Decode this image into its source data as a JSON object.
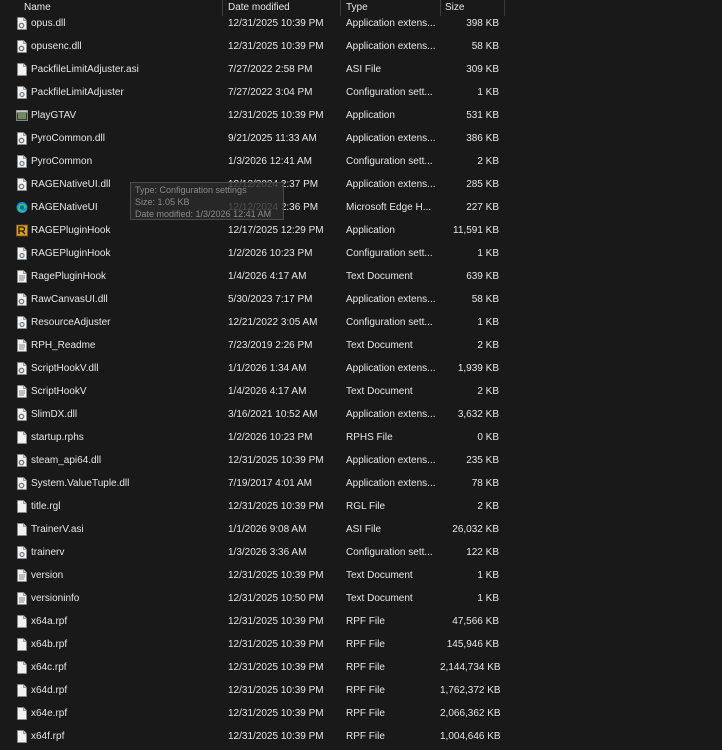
{
  "columns": {
    "name": "Name",
    "date": "Date modified",
    "type": "Type",
    "size": "Size"
  },
  "tooltip": {
    "type_line": "Type: Configuration settings",
    "size_line": "Size: 1.05 KB",
    "date_line": "Date modified: 1/3/2026 12:41 AM"
  },
  "rows": [
    {
      "name": "opus.dll",
      "date": "12/31/2025 10:39 PM",
      "type": "Application extens...",
      "size": "398 KB",
      "icon": "dll-file-icon"
    },
    {
      "name": "opusenc.dll",
      "date": "12/31/2025 10:39 PM",
      "type": "Application extens...",
      "size": "58 KB",
      "icon": "dll-file-icon"
    },
    {
      "name": "PackfileLimitAdjuster.asi",
      "date": "7/27/2022 2:58 PM",
      "type": "ASI File",
      "size": "309 KB",
      "icon": "file-icon"
    },
    {
      "name": "PackfileLimitAdjuster",
      "date": "7/27/2022 3:04 PM",
      "type": "Configuration sett...",
      "size": "1 KB",
      "icon": "config-file-icon"
    },
    {
      "name": "PlayGTAV",
      "date": "12/31/2025 10:39 PM",
      "type": "Application",
      "size": "531 KB",
      "icon": "app-icon"
    },
    {
      "name": "PyroCommon.dll",
      "date": "9/21/2025 11:33 AM",
      "type": "Application extens...",
      "size": "386 KB",
      "icon": "dll-file-icon"
    },
    {
      "name": "PyroCommon",
      "date": "1/3/2026 12:41 AM",
      "type": "Configuration sett...",
      "size": "2 KB",
      "icon": "config-file-icon"
    },
    {
      "name": "RAGENativeUI.dll",
      "date": "12/12/2024 2:37 PM",
      "type": "Application extens...",
      "size": "285 KB",
      "icon": "dll-file-icon"
    },
    {
      "name": "RAGENativeUI",
      "date": "12/12/2024 2:36 PM",
      "type": "Microsoft Edge H...",
      "size": "227 KB",
      "icon": "edge-icon"
    },
    {
      "name": "RAGEPluginHook",
      "date": "12/17/2025 12:29 PM",
      "type": "Application",
      "size": "11,591 KB",
      "icon": "rph-app-icon"
    },
    {
      "name": "RAGEPluginHook",
      "date": "1/2/2026 10:23 PM",
      "type": "Configuration sett...",
      "size": "1 KB",
      "icon": "config-file-icon"
    },
    {
      "name": "RagePluginHook",
      "date": "1/4/2026 4:17 AM",
      "type": "Text Document",
      "size": "639 KB",
      "icon": "text-file-icon"
    },
    {
      "name": "RawCanvasUI.dll",
      "date": "5/30/2023 7:17 PM",
      "type": "Application extens...",
      "size": "58 KB",
      "icon": "dll-file-icon"
    },
    {
      "name": "ResourceAdjuster",
      "date": "12/21/2022 3:05 AM",
      "type": "Configuration sett...",
      "size": "1 KB",
      "icon": "config-file-icon"
    },
    {
      "name": "RPH_Readme",
      "date": "7/23/2019 2:26 PM",
      "type": "Text Document",
      "size": "2 KB",
      "icon": "text-file-icon"
    },
    {
      "name": "ScriptHookV.dll",
      "date": "1/1/2026 1:34 AM",
      "type": "Application extens...",
      "size": "1,939 KB",
      "icon": "dll-file-icon"
    },
    {
      "name": "ScriptHookV",
      "date": "1/4/2026 4:17 AM",
      "type": "Text Document",
      "size": "2 KB",
      "icon": "text-file-icon"
    },
    {
      "name": "SlimDX.dll",
      "date": "3/16/2021 10:52 AM",
      "type": "Application extens...",
      "size": "3,632 KB",
      "icon": "dll-file-icon"
    },
    {
      "name": "startup.rphs",
      "date": "1/2/2026 10:23 PM",
      "type": "RPHS File",
      "size": "0 KB",
      "icon": "file-icon"
    },
    {
      "name": "steam_api64.dll",
      "date": "12/31/2025 10:39 PM",
      "type": "Application extens...",
      "size": "235 KB",
      "icon": "dll-file-icon"
    },
    {
      "name": "System.ValueTuple.dll",
      "date": "7/19/2017 4:01 AM",
      "type": "Application extens...",
      "size": "78 KB",
      "icon": "dll-file-icon"
    },
    {
      "name": "title.rgl",
      "date": "12/31/2025 10:39 PM",
      "type": "RGL File",
      "size": "2 KB",
      "icon": "file-icon"
    },
    {
      "name": "TrainerV.asi",
      "date": "1/1/2026 9:08 AM",
      "type": "ASI File",
      "size": "26,032 KB",
      "icon": "file-icon"
    },
    {
      "name": "trainerv",
      "date": "1/3/2026 3:36 AM",
      "type": "Configuration sett...",
      "size": "122 KB",
      "icon": "config-file-icon"
    },
    {
      "name": "version",
      "date": "12/31/2025 10:39 PM",
      "type": "Text Document",
      "size": "1 KB",
      "icon": "text-file-icon"
    },
    {
      "name": "versioninfo",
      "date": "12/31/2025 10:50 PM",
      "type": "Text Document",
      "size": "1 KB",
      "icon": "text-file-icon"
    },
    {
      "name": "x64a.rpf",
      "date": "12/31/2025 10:39 PM",
      "type": "RPF File",
      "size": "47,566 KB",
      "icon": "file-icon"
    },
    {
      "name": "x64b.rpf",
      "date": "12/31/2025 10:39 PM",
      "type": "RPF File",
      "size": "145,946 KB",
      "icon": "file-icon"
    },
    {
      "name": "x64c.rpf",
      "date": "12/31/2025 10:39 PM",
      "type": "RPF File",
      "size": "2,144,734 KB",
      "icon": "file-icon"
    },
    {
      "name": "x64d.rpf",
      "date": "12/31/2025 10:39 PM",
      "type": "RPF File",
      "size": "1,762,372 KB",
      "icon": "file-icon"
    },
    {
      "name": "x64e.rpf",
      "date": "12/31/2025 10:39 PM",
      "type": "RPF File",
      "size": "2,066,362 KB",
      "icon": "file-icon"
    },
    {
      "name": "x64f.rpf",
      "date": "12/31/2025 10:39 PM",
      "type": "RPF File",
      "size": "1,004,646 KB",
      "icon": "file-icon"
    }
  ]
}
